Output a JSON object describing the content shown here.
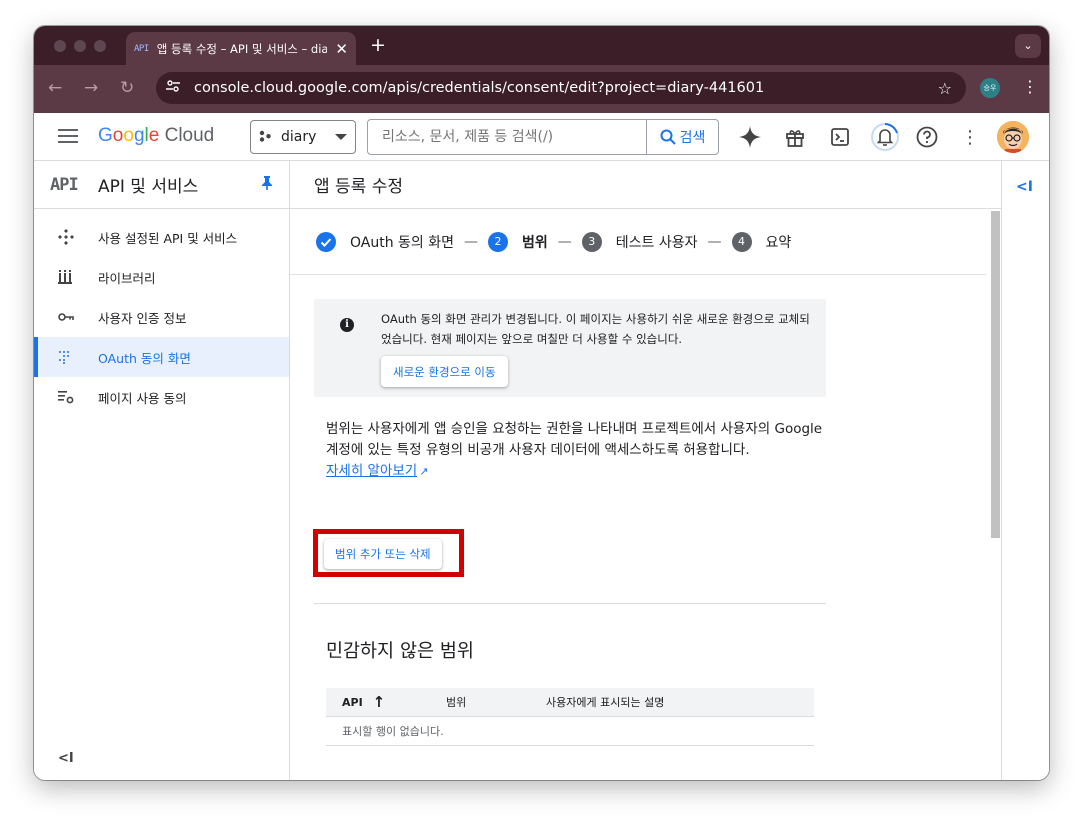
{
  "browser": {
    "tab_title": "앱 등록 수정 – API 및 서비스 – diary",
    "tab_favicon": "API",
    "url": "console.cloud.google.com/apis/credentials/consent/edit?project=diary-441601",
    "profile_label": "승우"
  },
  "header": {
    "logo": {
      "google": "Google",
      "cloud": "Cloud"
    },
    "project": "diary",
    "search_placeholder": "리소스, 문서, 제품 등 검색(/)",
    "search_button": "검색"
  },
  "sidebar": {
    "logo": "API",
    "title": "API 및 서비스",
    "items": [
      {
        "label": "사용 설정된 API 및 서비스",
        "icon": "api-diamond-icon"
      },
      {
        "label": "라이브러리",
        "icon": "library-icon"
      },
      {
        "label": "사용자 인증 정보",
        "icon": "key-icon"
      },
      {
        "label": "OAuth 동의 화면",
        "icon": "oauth-dots-icon",
        "active": true
      },
      {
        "label": "페이지 사용 동의",
        "icon": "settings-list-icon"
      }
    ],
    "collapse": "<I"
  },
  "main": {
    "page_title": "앱 등록 수정",
    "steps": [
      {
        "label": "OAuth 동의 화면",
        "state": "done"
      },
      {
        "num": "2",
        "label": "범위",
        "state": "current"
      },
      {
        "num": "3",
        "label": "테스트 사용자",
        "state": "todo"
      },
      {
        "num": "4",
        "label": "요약",
        "state": "todo"
      }
    ],
    "step_separator": "—",
    "notice": {
      "icon": "i",
      "text": "OAuth 동의 화면 관리가 변경됩니다. 이 페이지는 사용하기 쉬운 새로운 환경으로 교체되었습니다. 현재 페이지는 앞으로 며칠만 더 사용할 수 있습니다.",
      "button": "새로운 환경으로 이동"
    },
    "description": "범위는 사용자에게 앱 승인을 요청하는 권한을 나타내며 프로젝트에서 사용자의 Google 계정에 있는 특정 유형의 비공개 사용자 데이터에 액세스하도록 허용합니다.",
    "learn_more": "자세히 알아보기",
    "scope_button": "범위 추가 또는 삭제",
    "section_title": "민감하지 않은 범위",
    "table": {
      "columns": [
        "API",
        "범위",
        "사용자에게 표시되는 설명"
      ],
      "empty": "표시할 행이 없습니다."
    }
  },
  "right_rail": {
    "label": "<I"
  },
  "colors": {
    "accent": "#1a73e8",
    "highlight_box": "#d30000",
    "browser_frame": "#5b3945"
  }
}
